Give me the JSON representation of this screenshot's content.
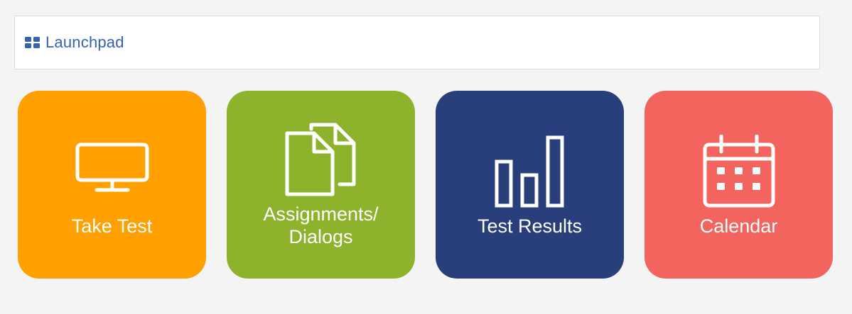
{
  "header": {
    "label": "Launchpad",
    "icon": "grid-icon",
    "color": "#3563b0"
  },
  "tiles": [
    {
      "id": "take-test",
      "label": "Take Test",
      "icon": "monitor-icon",
      "color": "#ffa000"
    },
    {
      "id": "assignments",
      "label_line1": "Assignments/",
      "label_line2": "Dialogs",
      "icon": "documents-icon",
      "color": "#8db32c"
    },
    {
      "id": "test-results",
      "label": "Test Results",
      "icon": "bar-chart-icon",
      "color": "#283f7b"
    },
    {
      "id": "calendar",
      "label": "Calendar",
      "icon": "calendar-icon",
      "color": "#f2645d"
    }
  ]
}
